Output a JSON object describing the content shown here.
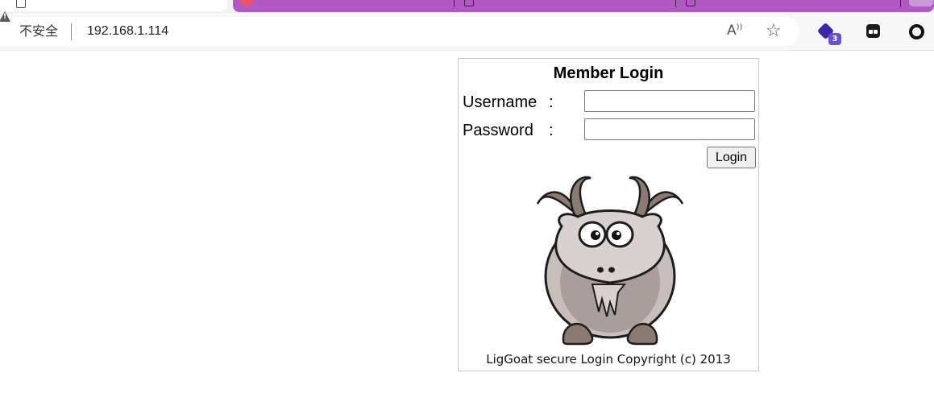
{
  "browser": {
    "security_label": "不安全",
    "url": "192.168.1.114",
    "extension_badge": "3"
  },
  "login": {
    "title": "Member Login",
    "username_label": "Username",
    "password_label": "Password",
    "colon": ":",
    "username_value": "",
    "password_value": "",
    "button_label": "Login",
    "copyright": "LigGoat secure Login Copyright (c) 2013"
  },
  "icons": {
    "security": "warning-triangle-icon",
    "read_aloud": "read-aloud-icon",
    "favorite": "star-icon",
    "mascot": "goat-illustration"
  },
  "colors": {
    "tab_strip_accent": "#b159c2",
    "goat_body": "#c8bfbd",
    "goat_horns": "#8a7a72"
  }
}
